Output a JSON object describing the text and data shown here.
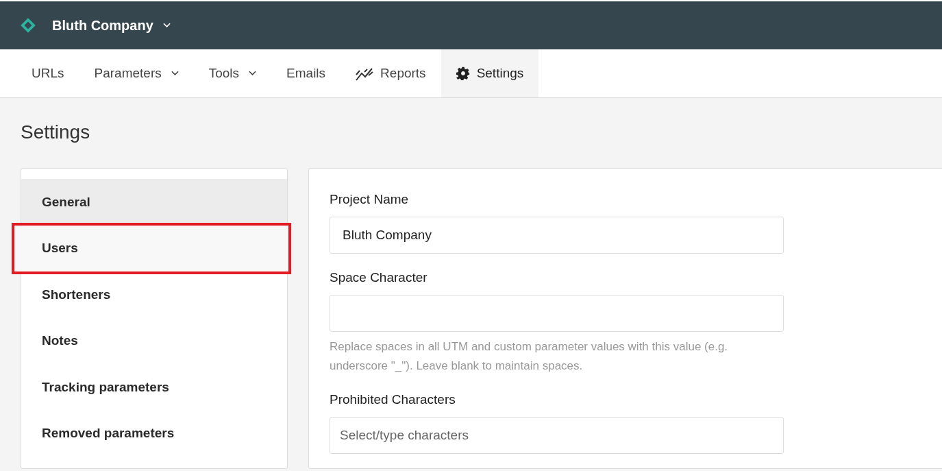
{
  "header": {
    "company": "Bluth Company"
  },
  "nav": [
    {
      "label": "URLs",
      "kind": "plain",
      "selected": false
    },
    {
      "label": "Parameters",
      "kind": "dropdown",
      "selected": false
    },
    {
      "label": "Tools",
      "kind": "dropdown",
      "selected": false
    },
    {
      "label": "Emails",
      "kind": "plain",
      "selected": false
    },
    {
      "label": "Reports",
      "kind": "chart",
      "selected": false
    },
    {
      "label": "Settings",
      "kind": "gear",
      "selected": true
    }
  ],
  "page_title": "Settings",
  "sidebar": {
    "items": [
      {
        "label": "General",
        "selected": true,
        "highlighted": false
      },
      {
        "label": "Users",
        "selected": false,
        "highlighted": true
      },
      {
        "label": "Shorteners",
        "selected": false,
        "highlighted": false
      },
      {
        "label": "Notes",
        "selected": false,
        "highlighted": false
      },
      {
        "label": "Tracking parameters",
        "selected": false,
        "highlighted": false
      },
      {
        "label": "Removed parameters",
        "selected": false,
        "highlighted": false
      }
    ]
  },
  "form": {
    "fields": [
      {
        "label": "Project Name",
        "kind": "text",
        "value": "Bluth Company"
      },
      {
        "label": "Space Character",
        "kind": "text",
        "hint": "Replace spaces in all UTM and custom parameter values with this value (e.g. underscore \"_\"). Leave blank to maintain spaces."
      },
      {
        "label": "Prohibited Characters",
        "kind": "select",
        "placeholder": "Select/type characters"
      }
    ]
  }
}
